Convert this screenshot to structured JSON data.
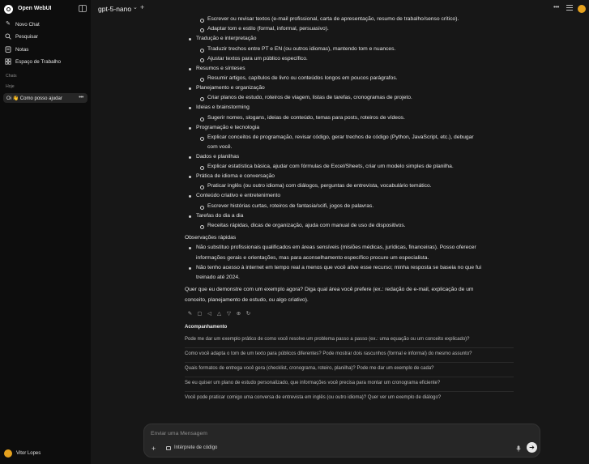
{
  "sidebar": {
    "app_name": "Open WebUI",
    "nav": [
      {
        "label": "Novo Chat",
        "icon": "pencil-icon"
      },
      {
        "label": "Pesquisar",
        "icon": "search-icon"
      },
      {
        "label": "Notas",
        "icon": "notes-icon"
      },
      {
        "label": "Espaço de Trabalho",
        "icon": "workspace-icon"
      }
    ],
    "section_chats": "Chats",
    "section_today": "Hoje",
    "chat_item": "Oi 👋 Como posso ajudar",
    "user_name": "Vitor Lopes"
  },
  "topbar": {
    "model": "gpt-5-nano"
  },
  "message": {
    "lines": [
      "Escrever ou revisar textos (e-mail profissional, carta de apresentação, resumo de trabalho/senso crítico).",
      "Adaptar tom e estilo (formal, informal, persuasivo).",
      "Tradução e interpretação",
      "Traduzir trechos entre PT e EN (ou outros idiomas), mantendo tom e nuances.",
      "Ajustar textos para um público específico.",
      "Resumos e sínteses",
      "Resumir artigos, capítulos de livro ou conteúdos longos em poucos parágrafos.",
      "Planejamento e organização",
      "Criar planos de estudo, roteiros de viagem, listas de tarefas, cronogramas de projeto.",
      "Ideias e brainstorming",
      "Sugerir nomes, slogans, ideias de conteúdo, temas para posts, roteiros de vídeos.",
      "Programação e tecnologia",
      "Explicar conceitos de programação, revisar código, gerar trechos de código (Python, JavaScript, etc.), debugar",
      "com você.",
      "Dados e planilhas",
      "Explicar estatística básica, ajudar com fórmulas de Excel/Sheets, criar um modelo simples de planilha.",
      "Prática de idioma e conversação",
      "Praticar inglês (ou outro idioma) com diálogos, perguntas de entrevista, vocabulário temático.",
      "Conteúdo criativo e entretenimento",
      "Escrever histórias curtas, roteiros de fantasia/scifi, jogos de palavras.",
      "Tarefas do dia a dia",
      "Receitas rápidas, dicas de organização, ajuda com manual de uso de dispositivos.",
      "Observações rápidas",
      "Não substituo profissionais qualificados em áreas sensíveis (misiões médicas, jurídicas, financeiras). Posso oferecer",
      "informações gerais e orientações, mas para aconselhamento específico procure um especialista.",
      "Não tenho acesso à internet em tempo real a menos que você ative esse recurso; minha resposta se baseia no que fui",
      "treinado até 2024.",
      "Quer que eu demonstre com um exemplo agora? Diga qual área você prefere (ex.: redação de e-mail, explicação de um",
      "conceito, planejamento de estudo, ou algo criativo)."
    ]
  },
  "followups": {
    "title": "Acompanhamento",
    "items": [
      "Pode me dar um exemplo prático de como você resolve um problema passo a passo (ex.: uma equação ou um conceito explicado)?",
      "Como você adapta o tom de um texto para públicos diferentes? Pode mostrar dois rascunhos (formal e informal) do mesmo assunto?",
      "Quais formatos de entrega você gera (checklist, cronograma, roteiro, planilha)? Pode me dar um exemplo de cada?",
      "Se eu quiser um plano de estudo personalizado, que informações você precisa para montar um cronograma eficiente?",
      "Você pode praticar comigo uma conversa de entrevista em inglês (ou outro idioma)? Quer ver um exemplo de diálogo?"
    ]
  },
  "composer": {
    "placeholder": "Enviar uma Mensagem",
    "tool_label": "Intérprete de código"
  },
  "colors": {
    "sidebar_bg": "#0d0d0d",
    "main_bg": "#171717",
    "avatar": "#e6a21e"
  }
}
